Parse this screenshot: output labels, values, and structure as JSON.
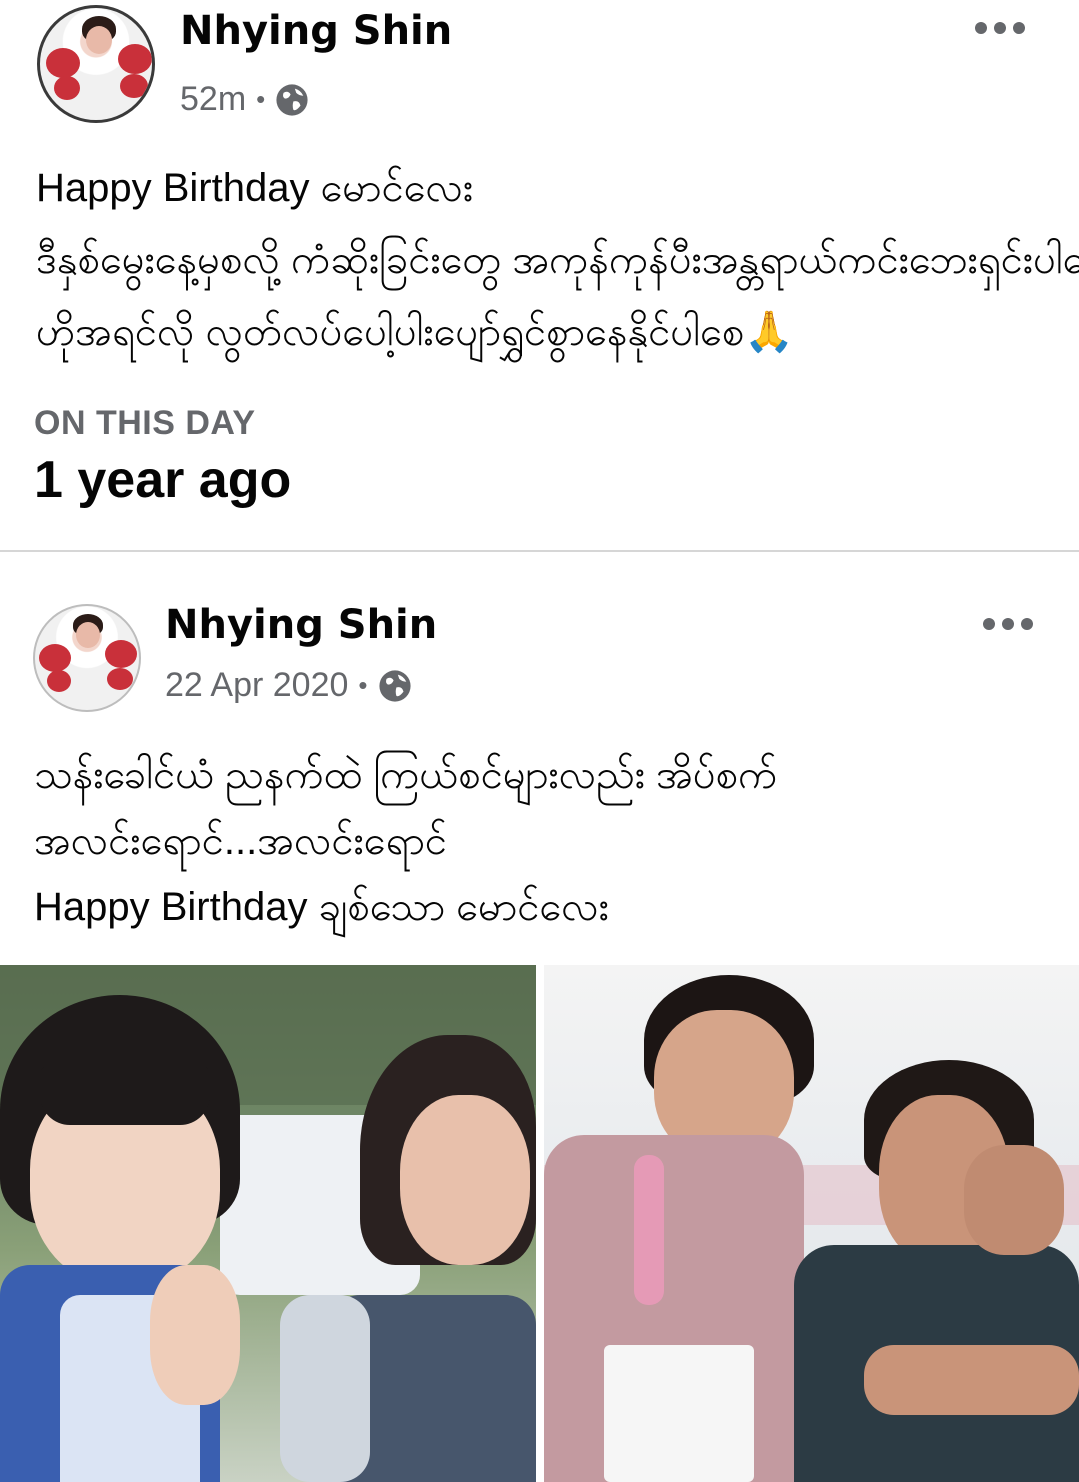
{
  "current_post": {
    "author": "Nhying Shin",
    "time": "52m",
    "separator": "•",
    "text_lines": [
      "Happy Birthday မောင်လေး",
      "ဒီနှစ်မွေးနေ့မှစလို့ ကံဆိုးခြင်းတွေ အကုန်ကုန်ပီးအန္တရာယ်ကင်းဘေးရှင်းပါစေ",
      "ဟိုအရင်လို လွတ်လပ်ပေါ့ပါးပျော်ရွှင်စွာနေနိုင်ပါစေ🙏"
    ]
  },
  "memory": {
    "label": "ON THIS DAY",
    "ago": "1 year ago"
  },
  "shared_post": {
    "author": "Nhying Shin",
    "date": "22 Apr 2020",
    "separator": "•",
    "text_lines": [
      "သန်းခေါင်ယံ ညနက်ထဲ ကြယ်စင်များလည်း အိပ်စက်",
      "အလင်းရောင်...အလင်းရောင်",
      "Happy Birthday ချစ်သော မောင်လေး"
    ]
  },
  "icons": {
    "privacy": "globe-icon",
    "options": "more-options-icon"
  },
  "colors": {
    "secondary_text": "#65676b",
    "primary_text": "#050505",
    "divider": "#d6d6d6"
  }
}
